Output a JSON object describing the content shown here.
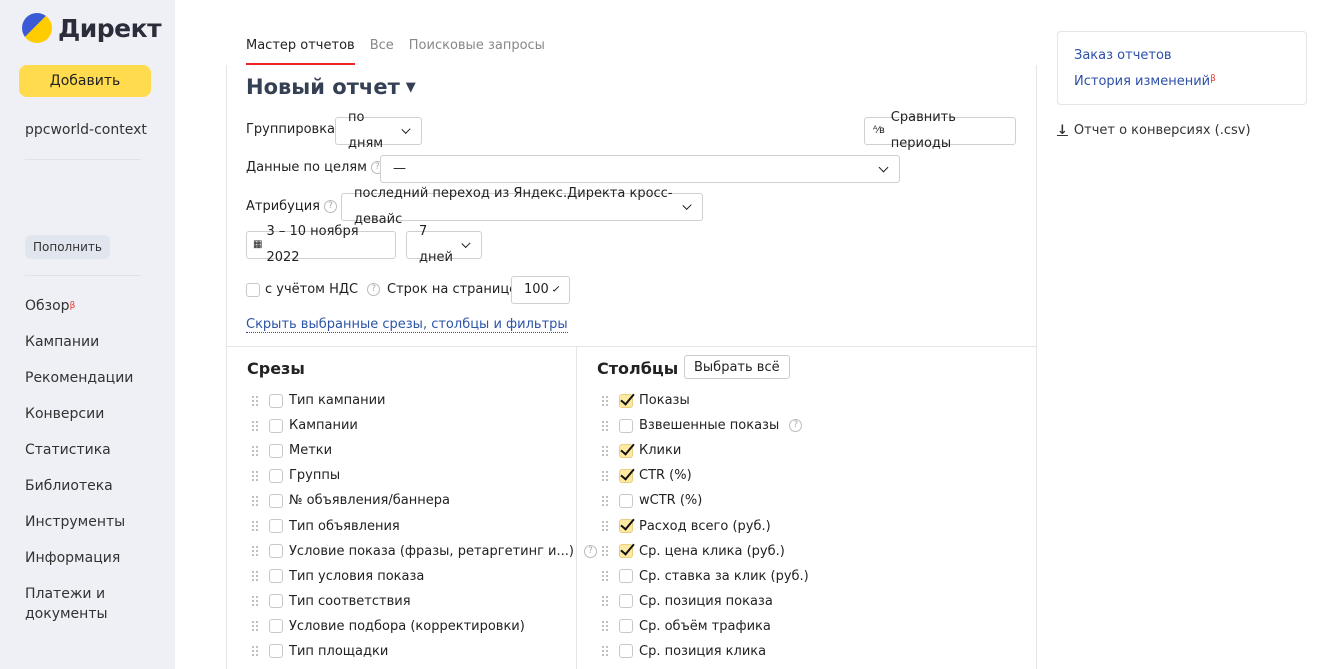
{
  "sidebar": {
    "logo": "Директ",
    "add": "Добавить",
    "login": "ppcworld-context",
    "topup": "Пополнить",
    "nav": [
      {
        "label": "Обзор",
        "beta": "β"
      },
      {
        "label": "Кампании"
      },
      {
        "label": "Рекомендации"
      },
      {
        "label": "Конверсии"
      },
      {
        "label": "Статистика"
      },
      {
        "label": "Библиотека"
      },
      {
        "label": "Инструменты"
      },
      {
        "label": "Информация"
      },
      {
        "label": "Платежи и документы"
      }
    ]
  },
  "tabs": [
    "Мастер отчетов",
    "Все",
    "Поисковые запросы"
  ],
  "title": "Новый отчет",
  "form": {
    "grouping_label": "Группировка",
    "grouping": "по дням",
    "compare": "Сравнить периоды",
    "goals_label": "Данные по целям",
    "goals": "—",
    "attr_label": "Атрибуция",
    "attr": "последний переход из Яндекс.Директа кросс-девайс",
    "date": "3 – 10 ноября 2022",
    "period": "7 дней",
    "vat": "с учётом НДС",
    "rows_label": "Строк на странице",
    "rows": "100",
    "hide_link": "Скрыть выбранные срезы, столбцы и фильтры"
  },
  "slices": {
    "title": "Срезы",
    "items": [
      {
        "label": "Тип кампании"
      },
      {
        "label": "Кампании"
      },
      {
        "label": "Метки"
      },
      {
        "label": "Группы"
      },
      {
        "label": "№ объявления/баннера"
      },
      {
        "label": "Тип объявления"
      },
      {
        "label": "Условие показа (фразы, ретаргетинг и...)",
        "help": true
      },
      {
        "label": "Тип условия показа"
      },
      {
        "label": "Тип соответствия"
      },
      {
        "label": "Условие подбора (корректировки)"
      },
      {
        "label": "Тип площадки"
      }
    ]
  },
  "columns": {
    "title": "Столбцы",
    "select_all": "Выбрать всё",
    "items": [
      {
        "label": "Показы",
        "checked": true
      },
      {
        "label": "Взвешенные показы",
        "checked": false,
        "help": true
      },
      {
        "label": "Клики",
        "checked": true
      },
      {
        "label": "CTR (%)",
        "checked": true
      },
      {
        "label": "wCTR (%)",
        "checked": false
      },
      {
        "label": "Расход всего (руб.)",
        "checked": true
      },
      {
        "label": "Ср. цена клика (руб.)",
        "checked": true
      },
      {
        "label": "Ср. ставка за клик (руб.)",
        "checked": false
      },
      {
        "label": "Ср. позиция показа",
        "checked": false
      },
      {
        "label": "Ср. объём трафика",
        "checked": false
      },
      {
        "label": "Ср. позиция клика",
        "checked": false
      }
    ]
  },
  "right": {
    "order": "Заказ отчетов",
    "history": "История изменений",
    "beta": "β",
    "csv": "Отчет о конверсиях (.csv)"
  }
}
